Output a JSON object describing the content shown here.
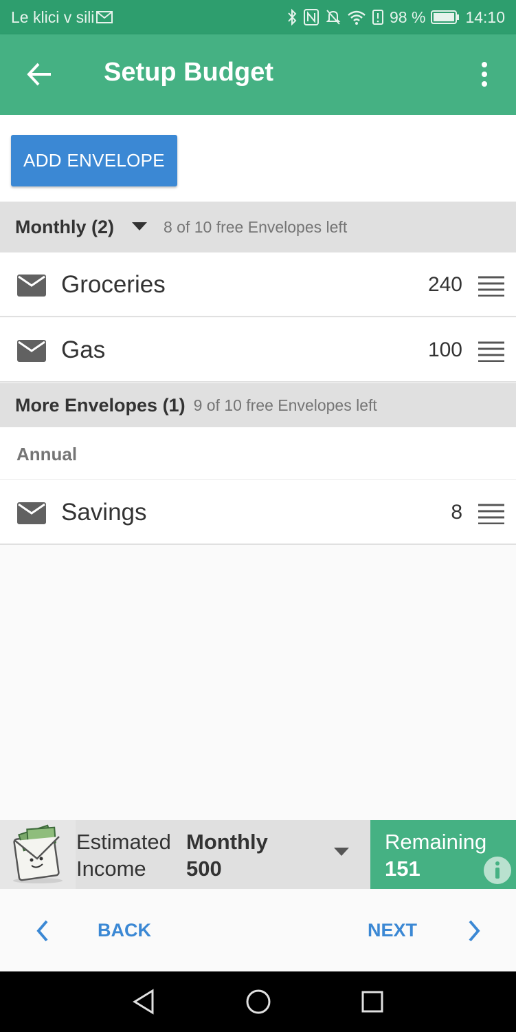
{
  "status_bar": {
    "carrier": "Le klici v sili",
    "battery_percent": "98 %",
    "time": "14:10"
  },
  "app_bar": {
    "title": "Setup Budget"
  },
  "actions": {
    "add_envelope_label": "ADD ENVELOPE"
  },
  "sections": [
    {
      "name": "Monthly (2)",
      "hint": "8 of 10 free Envelopes left",
      "items": [
        {
          "label": "Groceries",
          "amount": "240"
        },
        {
          "label": "Gas",
          "amount": "100"
        }
      ]
    },
    {
      "name": "More Envelopes (1)",
      "hint": "9 of 10 free Envelopes left",
      "group": "Annual",
      "items": [
        {
          "label": "Savings",
          "amount": "8"
        }
      ]
    }
  ],
  "income": {
    "label_line1": "Estimated",
    "label_line2": "Income",
    "period": "Monthly",
    "amount": "500"
  },
  "remaining": {
    "label": "Remaining",
    "value": "151"
  },
  "navigation": {
    "back_label": "BACK",
    "next_label": "NEXT"
  },
  "colors": {
    "status_bar": "#2e9e6e",
    "app_bar": "#45b183",
    "primary_button": "#3b88d4",
    "section_header": "#e0e0e0"
  }
}
